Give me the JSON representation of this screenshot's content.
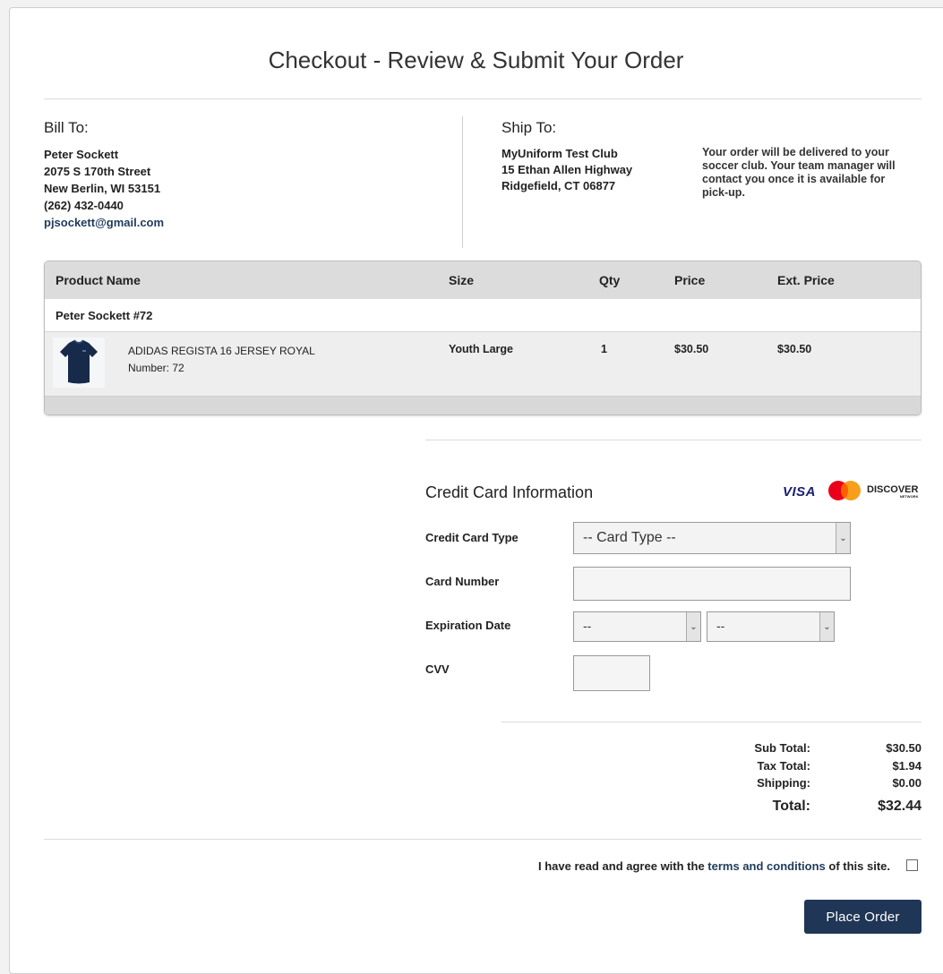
{
  "page": {
    "title": "Checkout - Review & Submit Your Order"
  },
  "bill_to": {
    "heading": "Bill To:",
    "name": "Peter Sockett",
    "street": "2075 S 170th Street",
    "city": "New Berlin, WI 53151",
    "phone": "(262) 432-0440",
    "email": "pjsockett@gmail.com"
  },
  "ship_to": {
    "heading": "Ship To:",
    "name": "MyUniform Test Club",
    "street": "15 Ethan Allen Highway",
    "city": "Ridgefield, CT 06877",
    "note": "Your order will be delivered to your soccer club. Your team manager will contact you once it is available for pick-up."
  },
  "order_table": {
    "columns": [
      "Product Name",
      "Size",
      "Qty",
      "Price",
      "Ext. Price"
    ],
    "group_label": "Peter Sockett #72",
    "items": [
      {
        "product": "ADIDAS REGISTA 16 JERSEY ROYAL",
        "detail": "Number: 72",
        "size": "Youth Large",
        "qty": "1",
        "price": "$30.50",
        "ext_price": "$30.50",
        "image_icon": "jersey-icon"
      }
    ]
  },
  "credit_card": {
    "heading": "Credit Card Information",
    "brands": {
      "visa": "VISA",
      "mastercard": "mastercard-icon",
      "discover": "DISCOVER",
      "discover_sub": "NETWORK"
    },
    "type_label": "Credit Card Type",
    "type_value": "-- Card Type --",
    "number_label": "Card Number",
    "number_value": "",
    "expiration_label": "Expiration Date",
    "exp_month_value": "--",
    "exp_year_value": "--",
    "cvv_label": "CVV",
    "cvv_value": ""
  },
  "totals": {
    "subtotal_label": "Sub Total:",
    "subtotal": "$30.50",
    "tax_label": "Tax Total:",
    "tax": "$1.94",
    "shipping_label": "Shipping:",
    "shipping": "$0.00",
    "total_label": "Total:",
    "total": "$32.44"
  },
  "agreement": {
    "prefix": "I have read and agree with the",
    "link": "terms and conditions",
    "suffix": "of this site.",
    "checked": false
  },
  "actions": {
    "place_order": "Place Order"
  },
  "colors": {
    "primary": "#1f3656",
    "link": "#1f3b5a",
    "table_header": "#dcdcdc"
  }
}
